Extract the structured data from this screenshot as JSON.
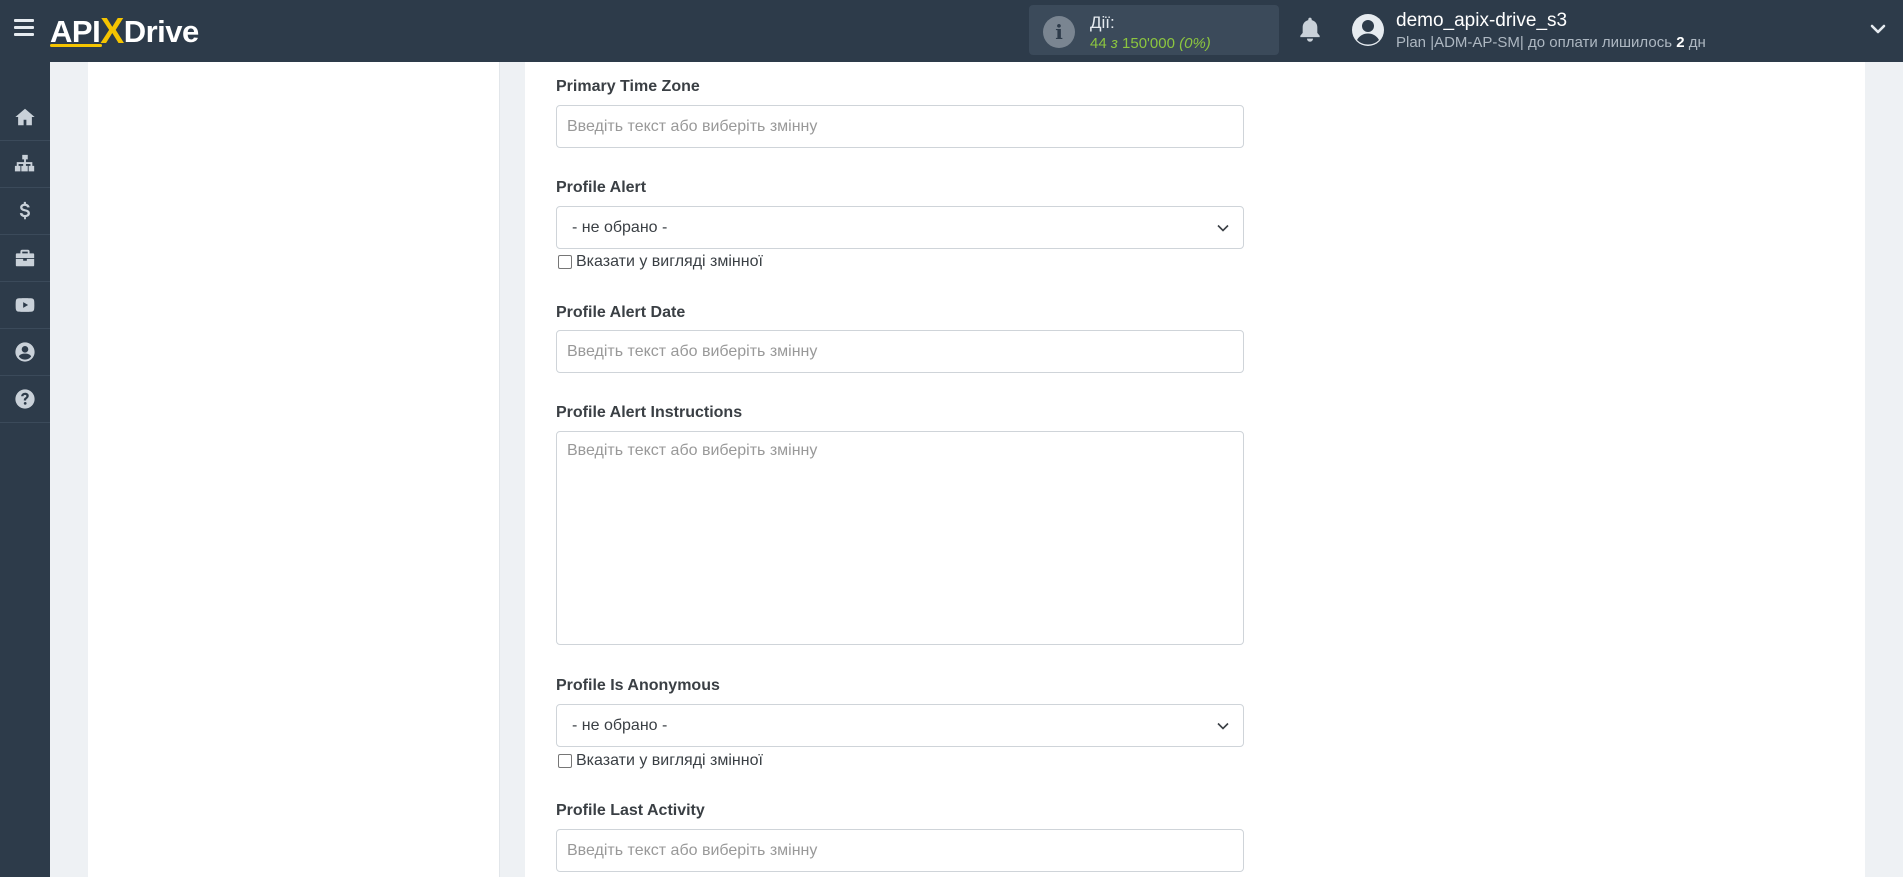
{
  "header": {
    "logo_left": "API",
    "logo_x": "X",
    "logo_right": "Drive",
    "actions_label": "Дії:",
    "actions_used": "44",
    "actions_of": "з",
    "actions_total": "150'000",
    "actions_percent": "(0%)",
    "user_name": "demo_apix-drive_s3",
    "plan_text": "Plan |ADM-AP-SM| до оплати лишилось",
    "plan_days": "2",
    "plan_days_unit": "дн"
  },
  "sidebar": {
    "items": [
      {
        "icon": "home-icon"
      },
      {
        "icon": "sitemap-icon"
      },
      {
        "icon": "dollar-icon"
      },
      {
        "icon": "briefcase-icon"
      },
      {
        "icon": "youtube-icon"
      },
      {
        "icon": "user-circle-icon"
      },
      {
        "icon": "question-icon"
      }
    ]
  },
  "form": {
    "placeholder": "Введіть текст або виберіть змінну",
    "not_selected": "- не обрано -",
    "as_variable": "Вказати у вигляді змінної",
    "fields": {
      "primary_time_zone": "Primary Time Zone",
      "profile_alert": "Profile Alert",
      "profile_alert_date": "Profile Alert Date",
      "profile_alert_instructions": "Profile Alert Instructions",
      "profile_is_anonymous": "Profile Is Anonymous",
      "profile_last_activity": "Profile Last Activity"
    }
  },
  "colors": {
    "topbar": "#2d3b4a",
    "accent": "#f5c400",
    "actions_green": "#8cc63f"
  }
}
